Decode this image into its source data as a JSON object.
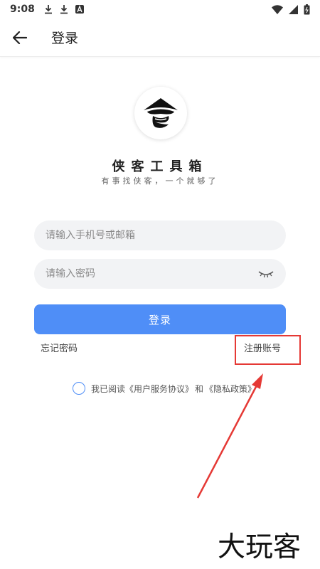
{
  "status_bar": {
    "time": "9:08",
    "icons": [
      "download-icon",
      "download-icon",
      "app-store-icon",
      "wifi-icon",
      "signal-icon",
      "battery-icon"
    ]
  },
  "app_bar": {
    "back_icon": "arrow-left-icon",
    "title": "登录"
  },
  "brand": {
    "logo_icon": "hat-logo-icon",
    "name": "侠客工具箱",
    "slogan": "有事找侠客，一个就够了"
  },
  "form": {
    "account_placeholder": "请输入手机号或邮箱",
    "account_value": "",
    "password_placeholder": "请输入密码",
    "password_value": "",
    "password_toggle_icon": "eye-closed-icon",
    "login_label": "登录"
  },
  "links": {
    "forgot": "忘记密码",
    "register": "注册账号"
  },
  "agreement": {
    "checked": false,
    "prefix": "我已阅读",
    "terms": "《用户服务协议》",
    "and": "和",
    "privacy": "《隐私政策》"
  },
  "colors": {
    "primary": "#4f8ef7",
    "highlight": "#e53935",
    "field_bg": "#f2f3f5"
  },
  "watermark": "大玩客"
}
